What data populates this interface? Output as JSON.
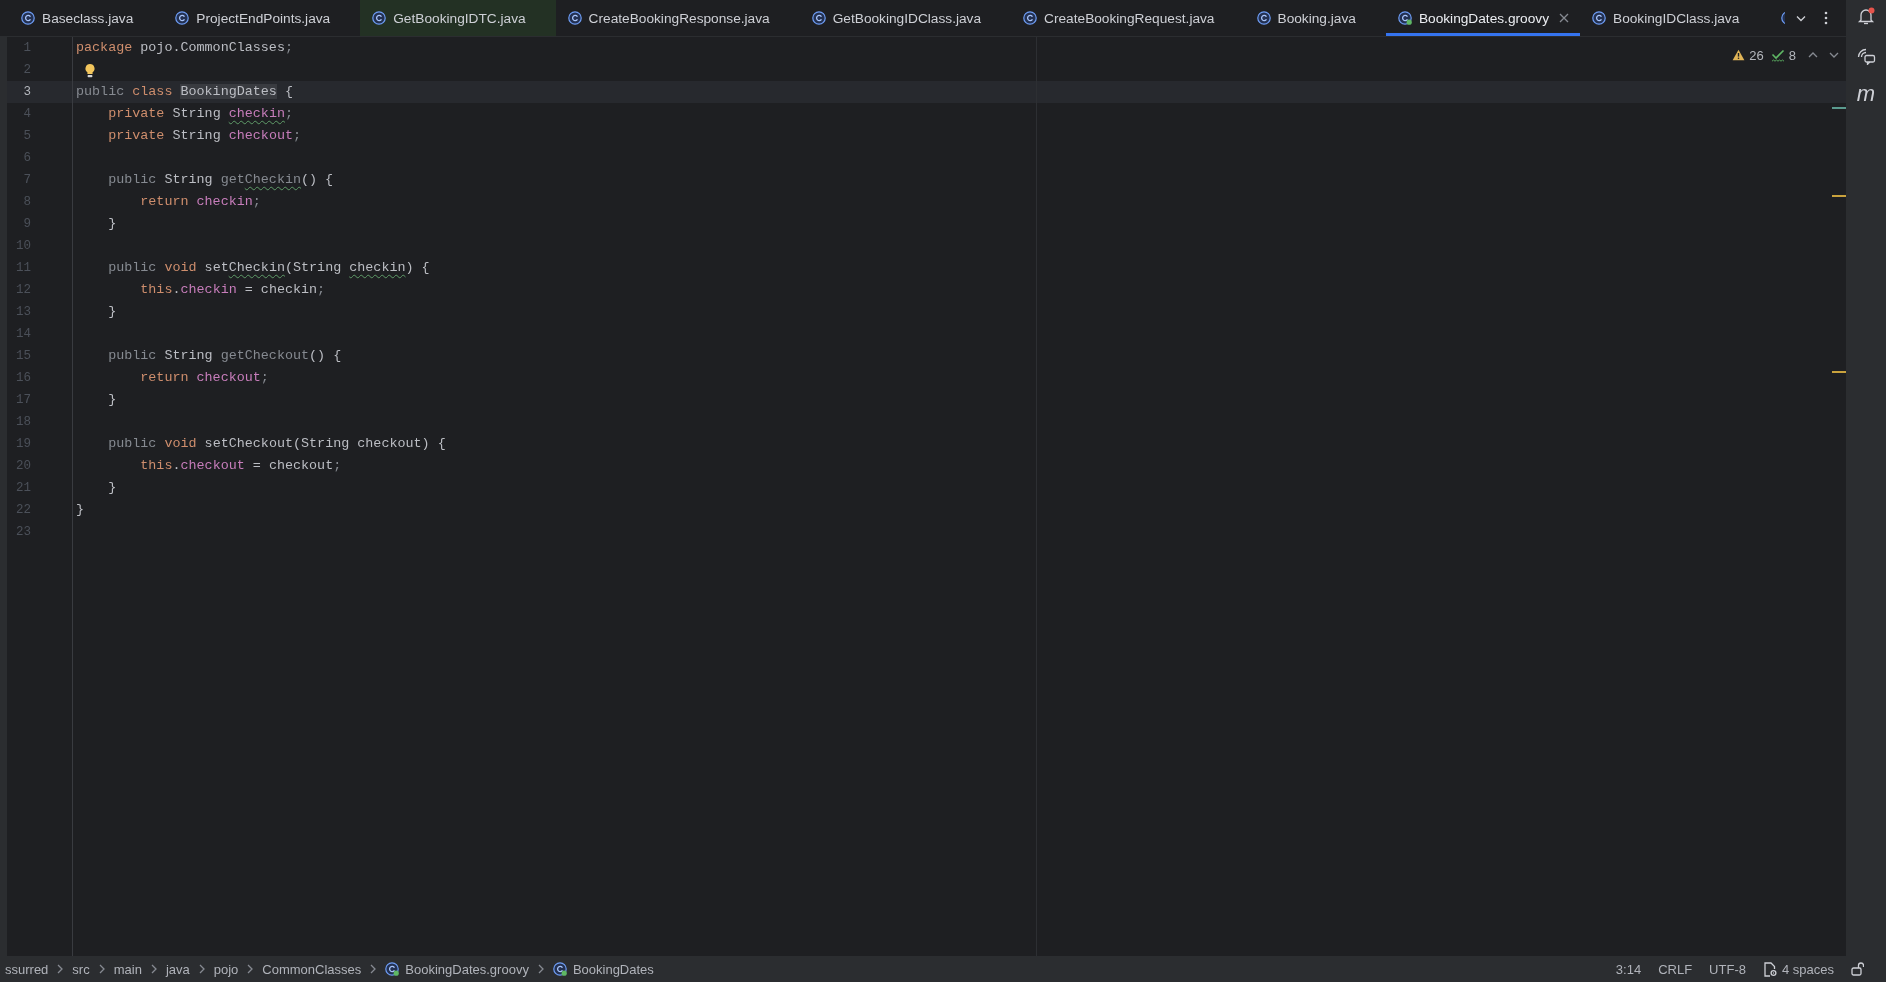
{
  "tabs": [
    {
      "label": "Baseclass.java",
      "kind": "java",
      "selected": false,
      "tinted": false
    },
    {
      "label": "ProjectEndPoints.java",
      "kind": "java",
      "selected": false,
      "tinted": false
    },
    {
      "label": "GetBookingIDTC.java",
      "kind": "java",
      "selected": false,
      "tinted": true
    },
    {
      "label": "CreateBookingResponse.java",
      "kind": "java",
      "selected": false,
      "tinted": false
    },
    {
      "label": "GetBookingIDClass.java",
      "kind": "java",
      "selected": false,
      "tinted": false
    },
    {
      "label": "CreateBookingRequest.java",
      "kind": "java",
      "selected": false,
      "tinted": false
    },
    {
      "label": "Booking.java",
      "kind": "java",
      "selected": false,
      "tinted": false
    },
    {
      "label": "BookingDates.groovy",
      "kind": "groovy",
      "selected": true,
      "tinted": false
    },
    {
      "label": "BookingIDClass.java",
      "kind": "java",
      "selected": false,
      "tinted": false
    }
  ],
  "editor": {
    "inspections": {
      "warnings": "26",
      "typos": "8"
    },
    "lines": [
      {
        "number": "1",
        "kind": "normal",
        "current": false,
        "bulb": false,
        "tokens": [
          {
            "kind": "keyword",
            "text": "package",
            "typo": false
          },
          {
            "kind": "plain",
            "text": " pojo.CommonClasses",
            "typo": false
          },
          {
            "kind": "dim",
            "text": ";",
            "typo": false
          }
        ]
      },
      {
        "number": "2",
        "kind": "normal",
        "current": false,
        "bulb": true
      },
      {
        "number": "3",
        "kind": "usage",
        "current": true,
        "bulb": false,
        "tokens": [
          {
            "kind": "dim",
            "text": "public ",
            "typo": false
          },
          {
            "kind": "keyword",
            "text": "class ",
            "typo": false
          },
          {
            "kind": "usage",
            "text": "BookingDates",
            "typo": false
          },
          {
            "kind": "plain",
            "text": " {",
            "typo": false
          }
        ]
      },
      {
        "number": "4",
        "kind": "normal",
        "current": false,
        "bulb": false,
        "tokens": [
          {
            "kind": "keyword",
            "text": "    private ",
            "typo": false
          },
          {
            "kind": "plain",
            "text": "String ",
            "typo": false
          },
          {
            "kind": "field",
            "text": "checkin",
            "typo": true
          },
          {
            "kind": "dim",
            "text": ";",
            "typo": false
          }
        ]
      },
      {
        "number": "5",
        "kind": "normal",
        "current": false,
        "bulb": false,
        "tokens": [
          {
            "kind": "keyword",
            "text": "    private ",
            "typo": false
          },
          {
            "kind": "plain",
            "text": "String ",
            "typo": false
          },
          {
            "kind": "field",
            "text": "checkout",
            "typo": false
          },
          {
            "kind": "dim",
            "text": ";",
            "typo": false
          }
        ]
      },
      {
        "number": "6",
        "kind": "normal",
        "current": false,
        "bulb": false
      },
      {
        "number": "7",
        "kind": "warning",
        "current": false,
        "bulb": false,
        "tokens": [
          {
            "kind": "dim",
            "text": "    public ",
            "typo": false
          },
          {
            "kind": "plain",
            "text": "String ",
            "typo": false
          },
          {
            "kind": "dim",
            "text": "get",
            "typo": false
          },
          {
            "kind": "dim",
            "text": "Checkin",
            "typo": true
          },
          {
            "kind": "plain",
            "text": "() {",
            "typo": false
          }
        ]
      },
      {
        "number": "8",
        "kind": "normal",
        "current": false,
        "bulb": false,
        "tokens": [
          {
            "kind": "keyword",
            "text": "        return ",
            "typo": false
          },
          {
            "kind": "field",
            "text": "checkin",
            "typo": false
          },
          {
            "kind": "dim",
            "text": ";",
            "typo": false
          }
        ]
      },
      {
        "number": "9",
        "kind": "normal",
        "current": false,
        "bulb": false,
        "tokens": [
          {
            "kind": "plain",
            "text": "    }",
            "typo": false
          }
        ]
      },
      {
        "number": "10",
        "kind": "normal",
        "current": false,
        "bulb": false
      },
      {
        "number": "11",
        "kind": "normal",
        "current": false,
        "bulb": false,
        "tokens": [
          {
            "kind": "dim",
            "text": "    public ",
            "typo": false
          },
          {
            "kind": "keyword",
            "text": "void ",
            "typo": false
          },
          {
            "kind": "plain",
            "text": "set",
            "typo": false
          },
          {
            "kind": "plain",
            "text": "Checkin",
            "typo": true
          },
          {
            "kind": "plain",
            "text": "(String ",
            "typo": false
          },
          {
            "kind": "plain",
            "text": "checkin",
            "typo": true
          },
          {
            "kind": "plain",
            "text": ") {",
            "typo": false
          }
        ]
      },
      {
        "number": "12",
        "kind": "normal",
        "current": false,
        "bulb": false,
        "tokens": [
          {
            "kind": "keyword",
            "text": "        this",
            "typo": false
          },
          {
            "kind": "plain",
            "text": ".",
            "typo": false
          },
          {
            "kind": "field",
            "text": "checkin",
            "typo": false
          },
          {
            "kind": "plain",
            "text": " = checkin",
            "typo": false
          },
          {
            "kind": "dim",
            "text": ";",
            "typo": false
          }
        ]
      },
      {
        "number": "13",
        "kind": "normal",
        "current": false,
        "bulb": false,
        "tokens": [
          {
            "kind": "plain",
            "text": "    }",
            "typo": false
          }
        ]
      },
      {
        "number": "14",
        "kind": "normal",
        "current": false,
        "bulb": false
      },
      {
        "number": "15",
        "kind": "warning",
        "current": false,
        "bulb": false,
        "tokens": [
          {
            "kind": "dim",
            "text": "    public ",
            "typo": false
          },
          {
            "kind": "plain",
            "text": "String ",
            "typo": false
          },
          {
            "kind": "dim",
            "text": "getCheckout",
            "typo": false
          },
          {
            "kind": "plain",
            "text": "() {",
            "typo": false
          }
        ]
      },
      {
        "number": "16",
        "kind": "normal",
        "current": false,
        "bulb": false,
        "tokens": [
          {
            "kind": "keyword",
            "text": "        return ",
            "typo": false
          },
          {
            "kind": "field",
            "text": "checkout",
            "typo": false
          },
          {
            "kind": "dim",
            "text": ";",
            "typo": false
          }
        ]
      },
      {
        "number": "17",
        "kind": "normal",
        "current": false,
        "bulb": false,
        "tokens": [
          {
            "kind": "plain",
            "text": "    }",
            "typo": false
          }
        ]
      },
      {
        "number": "18",
        "kind": "normal",
        "current": false,
        "bulb": false
      },
      {
        "number": "19",
        "kind": "normal",
        "current": false,
        "bulb": false,
        "tokens": [
          {
            "kind": "dim",
            "text": "    public ",
            "typo": false
          },
          {
            "kind": "keyword",
            "text": "void ",
            "typo": false
          },
          {
            "kind": "plain",
            "text": "setCheckout(String checkout) {",
            "typo": false
          }
        ]
      },
      {
        "number": "20",
        "kind": "normal",
        "current": false,
        "bulb": false,
        "tokens": [
          {
            "kind": "keyword",
            "text": "        this",
            "typo": false
          },
          {
            "kind": "plain",
            "text": ".",
            "typo": false
          },
          {
            "kind": "field",
            "text": "checkout",
            "typo": false
          },
          {
            "kind": "plain",
            "text": " = checkout",
            "typo": false
          },
          {
            "kind": "dim",
            "text": ";",
            "typo": false
          }
        ]
      },
      {
        "number": "21",
        "kind": "normal",
        "current": false,
        "bulb": false,
        "tokens": [
          {
            "kind": "plain",
            "text": "    }",
            "typo": false
          }
        ]
      },
      {
        "number": "22",
        "kind": "normal",
        "current": false,
        "bulb": false,
        "tokens": [
          {
            "kind": "plain",
            "text": "}",
            "typo": false
          }
        ]
      },
      {
        "number": "23",
        "kind": "normal",
        "current": false,
        "bulb": false
      }
    ]
  },
  "tool_strip": {
    "notifications_unread": true,
    "tool_glyph": "m"
  },
  "status_bar": {
    "breadcrumbs": [
      {
        "label": "ssurred",
        "kind": "folder"
      },
      {
        "label": "src",
        "kind": "folder"
      },
      {
        "label": "main",
        "kind": "folder"
      },
      {
        "label": "java",
        "kind": "folder"
      },
      {
        "label": "pojo",
        "kind": "folder"
      },
      {
        "label": "CommonClasses",
        "kind": "folder"
      },
      {
        "label": "BookingDates.groovy",
        "kind": "groovy"
      },
      {
        "label": "BookingDates",
        "kind": "groovy"
      }
    ],
    "caret": "3:14",
    "line_separator": "CRLF",
    "encoding": "UTF-8",
    "indent": "4 spaces",
    "read_only": false
  }
}
